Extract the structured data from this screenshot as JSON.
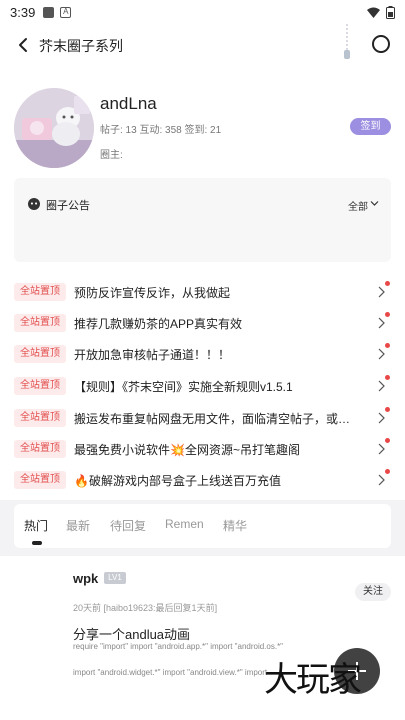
{
  "status_bar": {
    "time": "3:39"
  },
  "header_bar": {
    "title": "芥末圈子系列"
  },
  "circle": {
    "name": "andLna",
    "stats": "帖子: 13 互动: 358 签到: 21",
    "owner_label": "圈主:",
    "signin_label": "签到"
  },
  "announcement": {
    "title": "圈子公告",
    "filter_label": "全部"
  },
  "pinned": {
    "badge": "全站置顶",
    "items": [
      "预防反诈宣传反诈，从我做起",
      "推荐几款赚奶茶的APP真实有效",
      "开放加急审核帖子通道！！！",
      "【规则】《芥末空间》实施全新规则v1.5.1",
      "搬运发布重复帖网盘无用文件，面临清空帖子，或…",
      "最强免费小说软件💥全网资源~吊打笔趣阁",
      "🔥破解游戏内部号盒子上线送百万充值"
    ]
  },
  "tabs": [
    "热门",
    "最新",
    "待回复",
    "Remen",
    "精华"
  ],
  "post": {
    "username": "wpk",
    "level": "LV1",
    "meta": "20天前 [haibo19623:最后回复1天前]",
    "follow_label": "关注",
    "title": "分享一个andlua动画",
    "body_line1": "require \"import\" import \"android.app.*\" import \"android.os.*\"",
    "body_line2": "import \"android.widget.*\" import \"android.view.*\" import"
  },
  "watermark": "大玩家"
}
